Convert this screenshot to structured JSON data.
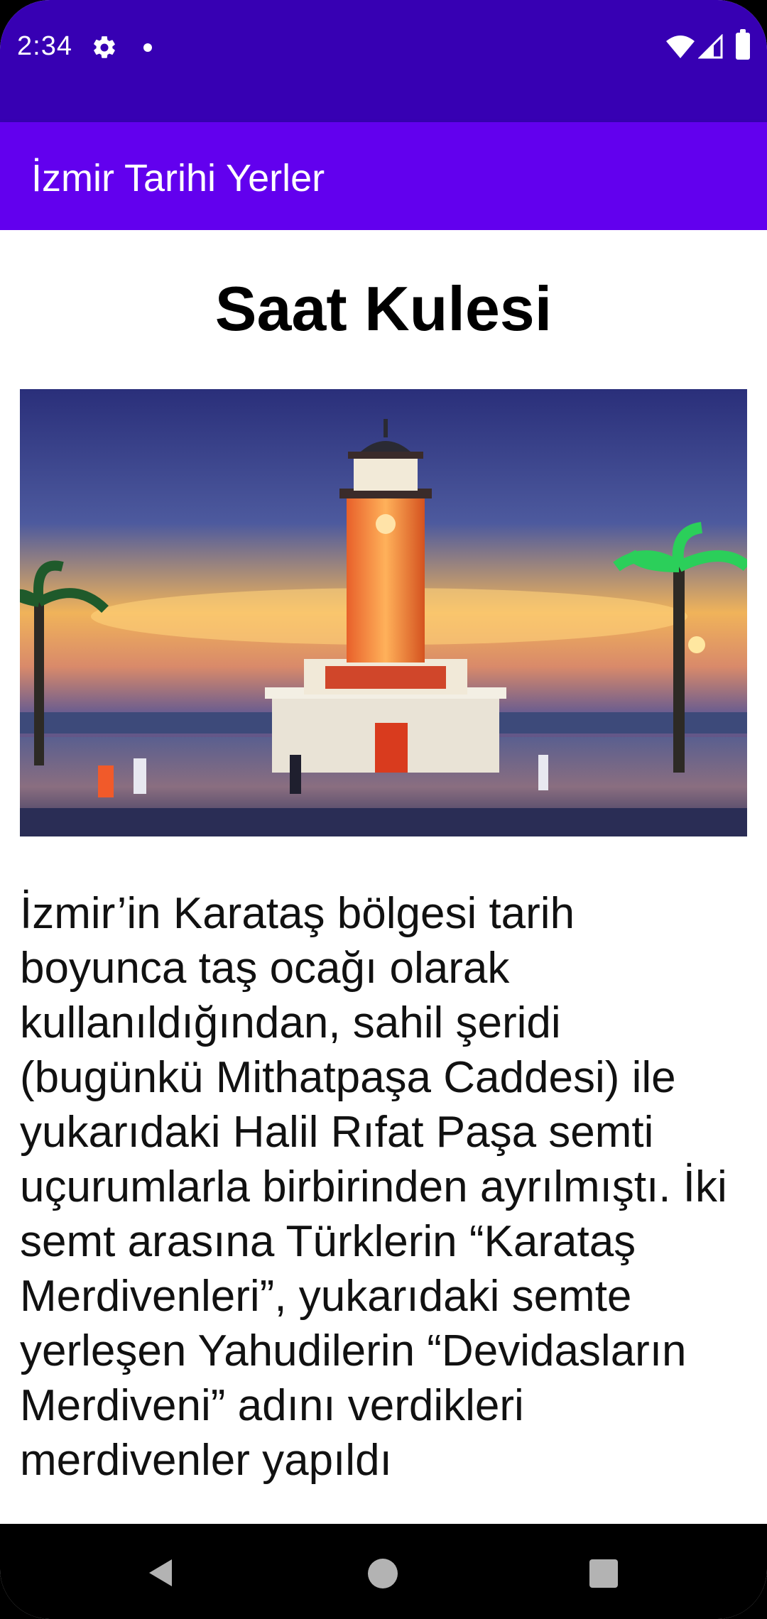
{
  "status_bar": {
    "time": "2:34",
    "icons": [
      "gear-icon",
      "notification-dot-icon",
      "wifi-icon",
      "signal-icon",
      "battery-icon"
    ]
  },
  "app_bar": {
    "title": "İzmir Tarihi Yerler",
    "color": "#6200ee",
    "status_color": "#3700b3"
  },
  "detail": {
    "title": "Saat Kulesi",
    "image_alt": "Saat Kulesi",
    "description": "İzmir’in Karataş bölgesi tarih boyunca taş ocağı olarak kullanıldığından, sahil şeridi (bugünkü Mithatpaşa Caddesi) ile yukarıdaki Halil Rıfat Paşa semti uçurumlarla birbirinden ayrılmıştı. İki semt arasına Türklerin “Karataş Merdivenleri”, yukarıdaki semte yerleşen Yahudilerin “Devidasların Merdiveni” adını verdikleri merdivenler yapıldı"
  },
  "nav_bar": {
    "buttons": [
      "back-icon",
      "home-icon",
      "recents-icon"
    ]
  }
}
